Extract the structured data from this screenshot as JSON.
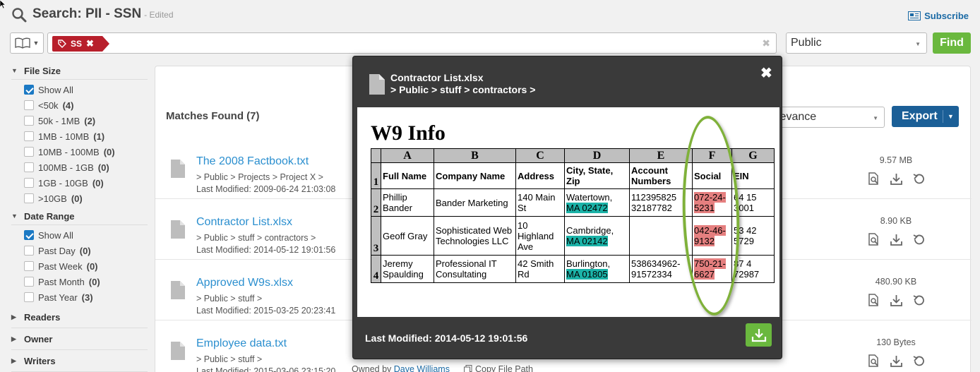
{
  "header": {
    "title": "Search: PII - SSN",
    "edited": "- Edited",
    "subscribe": "Subscribe"
  },
  "search": {
    "tag": "SS",
    "scope": "Public",
    "find_label": "Find"
  },
  "filters": [
    {
      "title": "File Size",
      "expanded": true,
      "items": [
        {
          "label": "Show All",
          "count": "",
          "checked": true
        },
        {
          "label": "<50k",
          "count": "(4)",
          "checked": false
        },
        {
          "label": "50k - 1MB",
          "count": "(2)",
          "checked": false
        },
        {
          "label": "1MB - 10MB",
          "count": "(1)",
          "checked": false
        },
        {
          "label": "10MB - 100MB",
          "count": "(0)",
          "checked": false
        },
        {
          "label": "100MB - 1GB",
          "count": "(0)",
          "checked": false
        },
        {
          "label": "1GB - 10GB",
          "count": "(0)",
          "checked": false
        },
        {
          "label": ">10GB",
          "count": "(0)",
          "checked": false
        }
      ]
    },
    {
      "title": "Date Range",
      "expanded": true,
      "items": [
        {
          "label": "Show All",
          "count": "",
          "checked": true
        },
        {
          "label": "Past Day",
          "count": "(0)",
          "checked": false
        },
        {
          "label": "Past Week",
          "count": "(0)",
          "checked": false
        },
        {
          "label": "Past Month",
          "count": "(0)",
          "checked": false
        },
        {
          "label": "Past Year",
          "count": "(3)",
          "checked": false
        }
      ]
    },
    {
      "title": "Readers",
      "expanded": false,
      "items": []
    },
    {
      "title": "Owner",
      "expanded": false,
      "items": []
    },
    {
      "title": "Writers",
      "expanded": false,
      "items": []
    }
  ],
  "results": {
    "matches_label": "Matches Found (7)",
    "sort_value": "levance",
    "export_label": "Export",
    "rows": [
      {
        "name": "The 2008 Factbook.txt",
        "path": "> Public > Projects > Project X >",
        "modified": "Last Modified: 2009-06-24 21:03:08",
        "size": "9.57 MB"
      },
      {
        "name": "Contractor List.xlsx",
        "path": "> Public > stuff > contractors >",
        "modified": "Last Modified: 2014-05-12 19:01:56",
        "size": "8.90 KB"
      },
      {
        "name": "Approved W9s.xlsx",
        "path": "> Public > stuff >",
        "modified": "Last Modified: 2015-03-25 20:23:41",
        "size": "480.90 KB"
      },
      {
        "name": "Employee data.txt",
        "path": "> Public > stuff >",
        "modified": "Last Modified: 2015-03-06 23:15:20",
        "size": "130 Bytes"
      }
    ],
    "last_row_owner_prefix": "Owned by",
    "last_row_owner": "Dave Williams",
    "copy_path_label": "Copy File Path"
  },
  "popup": {
    "title": "Contractor List.xlsx",
    "path": "> Public > stuff > contractors >",
    "last_modified": "Last Modified: 2014-05-12 19:01:56",
    "sheet_title": "W9 Info",
    "col_letters": [
      "A",
      "B",
      "C",
      "D",
      "E",
      "F",
      "G"
    ],
    "header_row": {
      "num": "1",
      "cells": [
        "Full Name",
        "Company Name",
        "Address",
        "City, State, Zip",
        "Account Numbers",
        "Social",
        "EIN"
      ]
    },
    "rows": [
      {
        "num": "2",
        "name": "Phillip Bander",
        "company": "Bander Marketing",
        "address": "140 Main St",
        "city": "Watertown,",
        "zip": "MA 02472",
        "account": "112395825 32187782",
        "ssn": "072-24-5231",
        "ein": "64 15 3001"
      },
      {
        "num": "3",
        "name": "Geoff Gray",
        "company": "Sophisticated Web Technologies LLC",
        "address": "10 Highland Ave",
        "city": "Cambridge,",
        "zip": "MA 02142",
        "account": "",
        "ssn": "042-46-9132",
        "ein": "53 42 5729"
      },
      {
        "num": "4",
        "name": "Jeremy Spaulding",
        "company": "Professional IT Consultating",
        "address": "42 Smith Rd",
        "city": "Burlington,",
        "zip": "MA 01805",
        "account": "538634962-91572334",
        "ssn": "750-21-6627",
        "ein": "87 4 72987"
      }
    ]
  },
  "colors": {
    "accent_blue": "#1b5f97",
    "link_blue": "#2b8fcf",
    "green": "#6ab83e",
    "tag_red": "#b81f2b",
    "zip_teal": "#1bb3a8",
    "ssn_red": "#e57f7f"
  }
}
